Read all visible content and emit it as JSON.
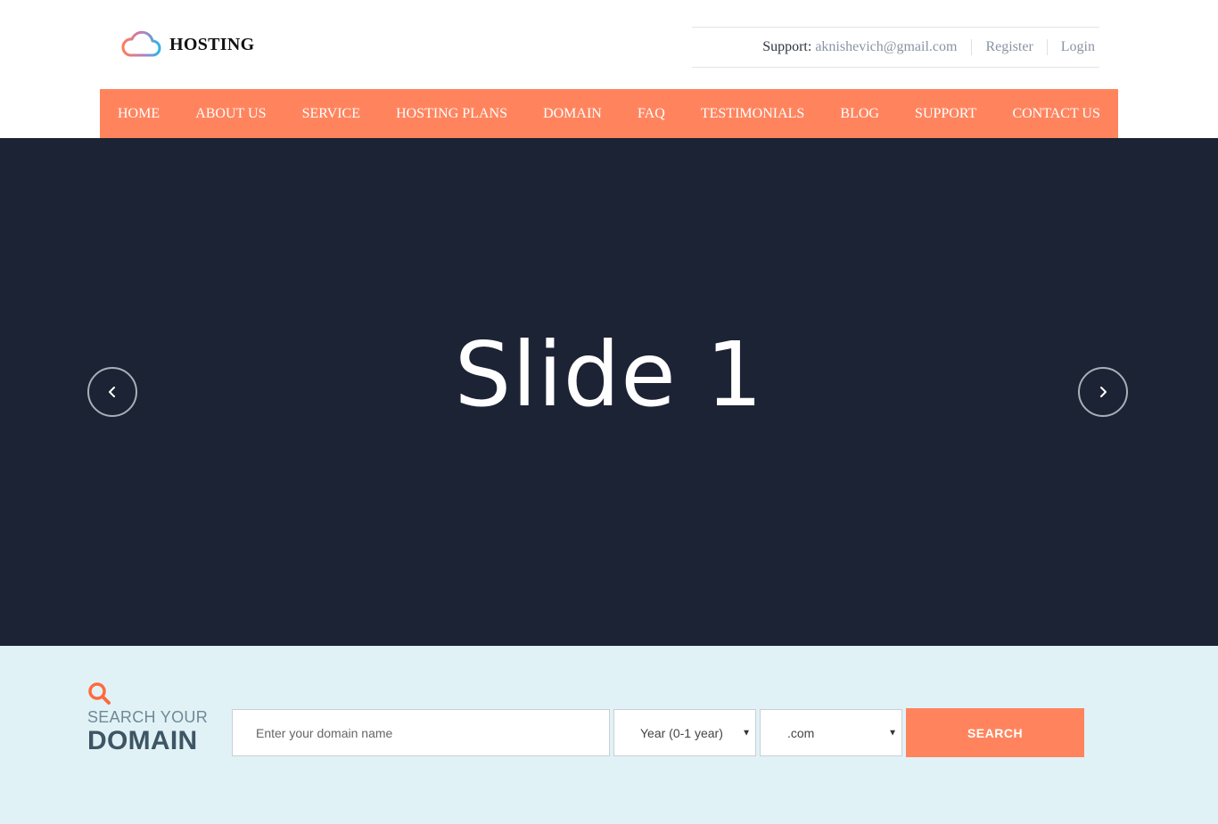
{
  "brand": {
    "name": "HOSTING",
    "logo_icon": "cloud-icon"
  },
  "topbar": {
    "support_label": "Support:",
    "support_email": "aknishevich@gmail.com",
    "register": "Register",
    "login": "Login"
  },
  "nav": {
    "items": [
      {
        "label": "HOME"
      },
      {
        "label": "ABOUT US"
      },
      {
        "label": "SERVICE"
      },
      {
        "label": "HOSTING PLANS"
      },
      {
        "label": "DOMAIN"
      },
      {
        "label": "FAQ"
      },
      {
        "label": "TESTIMONIALS"
      },
      {
        "label": "BLOG"
      },
      {
        "label": "SUPPORT"
      },
      {
        "label": "CONTACT US"
      }
    ]
  },
  "slider": {
    "title": "Slide 1",
    "prev_icon": "chevron-left-icon",
    "next_icon": "chevron-right-icon"
  },
  "domain_search": {
    "icon": "search-icon",
    "heading_small": "SEARCH YOUR",
    "heading_large": "DOMAIN",
    "input_placeholder": "Enter your domain name",
    "period_selected": "Year (0-1 year)",
    "tld_selected": ".com",
    "button_label": "SEARCH"
  },
  "colors": {
    "accent": "#ff845e",
    "slider_bg": "#1c2334",
    "search_section_bg": "#e1f2f7",
    "heading_dark": "#3e5663"
  }
}
